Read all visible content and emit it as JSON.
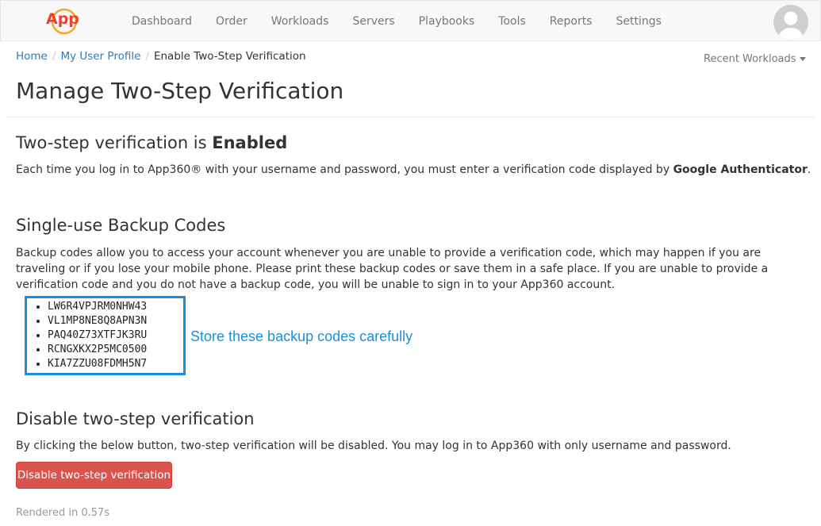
{
  "nav": {
    "logo_text": "App",
    "items": [
      "Dashboard",
      "Order",
      "Workloads",
      "Servers",
      "Playbooks",
      "Tools",
      "Reports",
      "Settings"
    ]
  },
  "breadcrumb": {
    "home": "Home",
    "profile": "My User Profile",
    "current": "Enable Two-Step Verification"
  },
  "recent_workloads": "Recent Workloads",
  "page_title": "Manage Two-Step Verification",
  "status": {
    "heading_prefix": "Two-step verification is ",
    "heading_state": "Enabled",
    "desc_prefix": "Each time you log in to App360® with your username and password, you must enter a verification code displayed by ",
    "desc_app": "Google Authenticator",
    "desc_suffix": "."
  },
  "backup": {
    "heading": "Single-use Backup Codes",
    "description": "Backup codes allow you to access your account whenever you are unable to provide a verification code, which may happen if you are traveling or if you lose your mobile phone. Please print these backup codes or save them in a safe place. If you are unable to provide a verification code and you do not have a backup code, you will be unable to sign in to your App360 account.",
    "codes": [
      "LW6R4VPJRM0NHW43",
      "VL1MP8NE8Q8APN3N",
      "PAQ40Z73XTFJK3RU",
      "RCNGXKX2P5MC0500",
      "KIA7ZZU08FDMH5N7"
    ],
    "annotation": "Store these backup codes carefully"
  },
  "disable": {
    "heading": "Disable two-step verification",
    "description": "By clicking the below button, two-step verification will be disabled. You may log in to App360 with only username and password.",
    "button_label": "Disable two-step verification"
  },
  "footer": "Rendered in 0.57s",
  "colors": {
    "link": "#337ab7",
    "danger": "#d9534f",
    "highlight": "#1a8fdb",
    "logo_orange": "#f5a623",
    "logo_red": "#e8412c"
  }
}
